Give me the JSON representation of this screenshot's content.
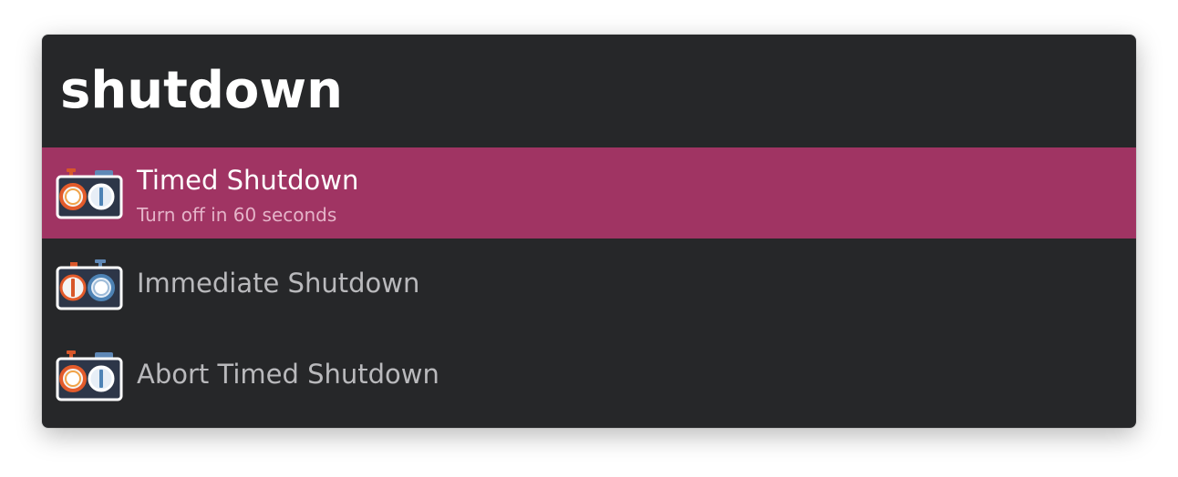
{
  "search": {
    "query": "shutdown"
  },
  "results": [
    {
      "title": "Timed Shutdown",
      "subtitle": "Turn off in 60 seconds",
      "icon": "shutdown-timer-icon",
      "selected": true
    },
    {
      "title": "Immediate Shutdown",
      "subtitle": "",
      "icon": "shutdown-timer-icon",
      "selected": false
    },
    {
      "title": "Abort Timed Shutdown",
      "subtitle": "",
      "icon": "shutdown-timer-icon",
      "selected": false
    }
  ],
  "colors": {
    "window_background": "#262729",
    "selection": "#a03463",
    "query_text": "#ffffff",
    "title_text": "#b9b9bc",
    "selected_subtitle_text": "#e5b4c9"
  }
}
